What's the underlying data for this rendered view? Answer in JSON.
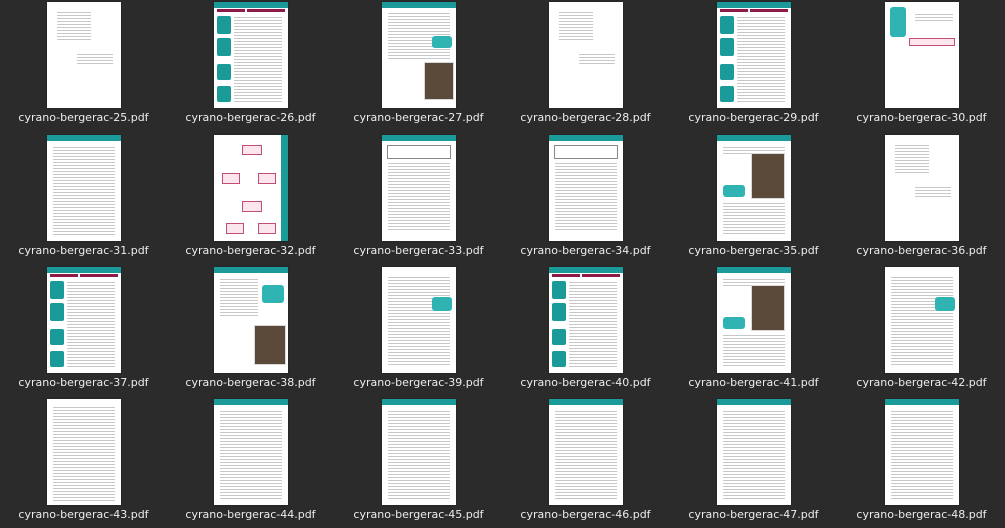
{
  "files": [
    {
      "name": "cyrano-bergerac-25.pdf",
      "style": "sparse"
    },
    {
      "name": "cyrano-bergerac-26.pdf",
      "style": "table-sidebar"
    },
    {
      "name": "cyrano-bergerac-27.pdf",
      "style": "header-text-pic"
    },
    {
      "name": "cyrano-bergerac-28.pdf",
      "style": "sparse"
    },
    {
      "name": "cyrano-bergerac-29.pdf",
      "style": "table-sidebar"
    },
    {
      "name": "cyrano-bergerac-30.pdf",
      "style": "box-only"
    },
    {
      "name": "cyrano-bergerac-31.pdf",
      "style": "header-text"
    },
    {
      "name": "cyrano-bergerac-32.pdf",
      "style": "diagram"
    },
    {
      "name": "cyrano-bergerac-33.pdf",
      "style": "header-form"
    },
    {
      "name": "cyrano-bergerac-34.pdf",
      "style": "header-form"
    },
    {
      "name": "cyrano-bergerac-35.pdf",
      "style": "header-pic"
    },
    {
      "name": "cyrano-bergerac-36.pdf",
      "style": "sparse"
    },
    {
      "name": "cyrano-bergerac-37.pdf",
      "style": "table-sidebar"
    },
    {
      "name": "cyrano-bergerac-38.pdf",
      "style": "header-box-pic"
    },
    {
      "name": "cyrano-bergerac-39.pdf",
      "style": "box-text"
    },
    {
      "name": "cyrano-bergerac-40.pdf",
      "style": "table-sidebar"
    },
    {
      "name": "cyrano-bergerac-41.pdf",
      "style": "header-pic"
    },
    {
      "name": "cyrano-bergerac-42.pdf",
      "style": "box-text"
    },
    {
      "name": "cyrano-bergerac-43.pdf",
      "style": "text"
    },
    {
      "name": "cyrano-bergerac-44.pdf",
      "style": "header-text"
    },
    {
      "name": "cyrano-bergerac-45.pdf",
      "style": "header-text"
    },
    {
      "name": "cyrano-bergerac-46.pdf",
      "style": "header-text"
    },
    {
      "name": "cyrano-bergerac-47.pdf",
      "style": "header-text"
    },
    {
      "name": "cyrano-bergerac-48.pdf",
      "style": "header-text"
    }
  ],
  "colors": {
    "background": "#2b2b2b",
    "accent": "#1b9a9a",
    "tag": "#8d1a4a",
    "caption": "#ececec"
  }
}
